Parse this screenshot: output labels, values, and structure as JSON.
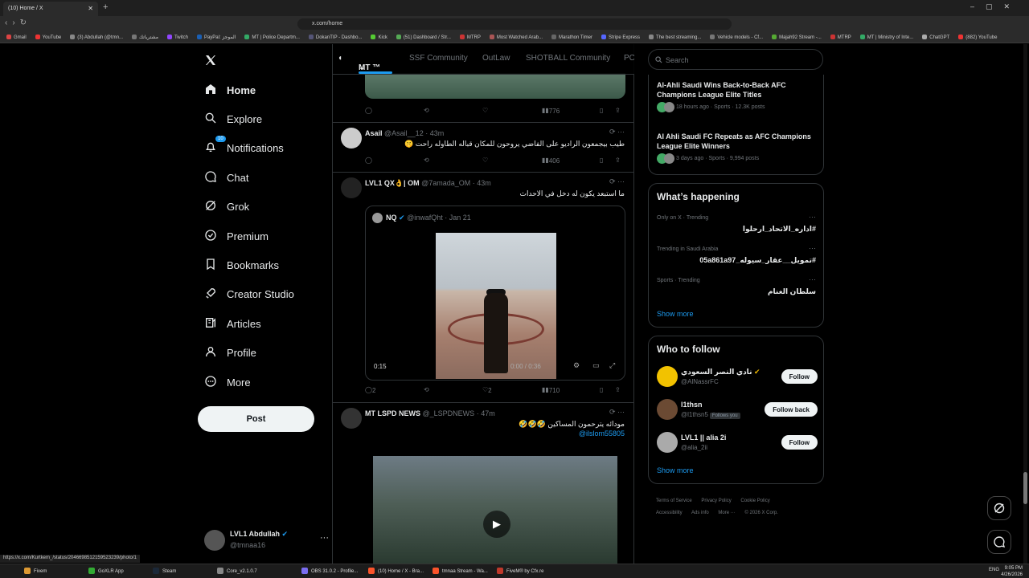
{
  "browser": {
    "tab_title": "(10) Home / X",
    "url": "x.com/home",
    "bookmarks": [
      "Gmail",
      "YouTube",
      "(3) Abdullah (@tmn...",
      "مشترياتك",
      "Twitch",
      "PayPal: الموجز",
      "MT | Police Departm...",
      "DokanTIP - Dashbo...",
      "Kick",
      "(51) Dashboard / Str...",
      "MTRP",
      "Most Watched Arab...",
      "Marathon Timer",
      "Stripe Express",
      "The best streaming...",
      "Vehicle models - Cf...",
      "Majah92 Stream -...",
      "MTRP",
      "MT | Ministry of Inte...",
      "ChatGPT",
      "(882) YouTube"
    ],
    "status_url": "https://x.com/Kurtkem_/status/2046698512159523239/photo/1"
  },
  "nav": {
    "logo": "X",
    "items": [
      {
        "label": "Home",
        "icon": "home-icon"
      },
      {
        "label": "Explore",
        "icon": "search-icon"
      },
      {
        "label": "Notifications",
        "icon": "bell-icon",
        "badge": "10"
      },
      {
        "label": "Chat",
        "icon": "chat-icon"
      },
      {
        "label": "Grok",
        "icon": "grok-icon"
      },
      {
        "label": "Premium",
        "icon": "premium-icon"
      },
      {
        "label": "Bookmarks",
        "icon": "bookmark-icon"
      },
      {
        "label": "Creator Studio",
        "icon": "rocket-icon"
      },
      {
        "label": "Articles",
        "icon": "articles-icon"
      },
      {
        "label": "Profile",
        "icon": "person-icon"
      },
      {
        "label": "More",
        "icon": "more-circle-icon"
      }
    ],
    "post_label": "Post",
    "account": {
      "name": "LVL1 Abdullah",
      "handle": "@tmnaa16"
    }
  },
  "feed": {
    "tabs": [
      "MT ™",
      "SSF Community",
      "OutLaw",
      "SHOTBALL Community",
      "PC"
    ],
    "top_tweet": {
      "views": "776"
    },
    "tweets": [
      {
        "name": "Asail",
        "handle": "@Asail__12",
        "time": "43m",
        "text": "طيب بيجمعون الراديو على الفاضي يروحون للمكان قباله الطاوله راحت 🤫",
        "views": "406"
      },
      {
        "name": "LVL1 QX👌| OM",
        "handle": "@7amada_OM",
        "time": "43m",
        "text": "ما استبعد يكون له دخل في الاحداث",
        "quote": {
          "name": "NQ",
          "handle": "@inwafQht",
          "date": "Jan 21",
          "duration": "0:15",
          "progress": "0:00 / 0:36"
        },
        "replies": "2",
        "likes": "2",
        "views": "710"
      },
      {
        "name": "MT LSPD NEWS",
        "handle": "@_LSPDNEWS",
        "time": "47m",
        "text": "مودائه يترحمون المساكين 🤣🤣🤣",
        "mention": "@ilslom55805"
      }
    ]
  },
  "right": {
    "search_placeholder": "Search",
    "news": [
      {
        "title": "Al-Ahli Saudi Wins Back-to-Back AFC Champions League Elite Titles",
        "meta": "18 hours ago · Sports · 12.3K posts"
      },
      {
        "title": "Al Ahli Saudi FC Repeats as AFC Champions League Elite Winners",
        "meta": "3 days ago · Sports · 9,994 posts"
      }
    ],
    "happening_title": "What’s happening",
    "trends": [
      {
        "context": "Only on X · Trending",
        "topic": "#اداره_الاتحاد_ارحلوا"
      },
      {
        "context": "Trending in Saudi Arabia",
        "topic": "#تمويل__عقار_سيوله_05a861a97"
      },
      {
        "context": "Sports · Trending",
        "topic": "سلطان الغنام"
      }
    ],
    "show_more": "Show more",
    "follow_title": "Who to follow",
    "follows": [
      {
        "name": "نادي النصر السعودي",
        "handle": "@AlNassrFC",
        "button": "Follow"
      },
      {
        "name": "l1thsn",
        "handle": "@l1thsn5",
        "follows_you": "Follows you",
        "button": "Follow back"
      },
      {
        "name": "LVL1 || alia 2i",
        "handle": "@alia_2ii",
        "button": "Follow"
      }
    ],
    "footer": [
      "Terms of Service",
      "Privacy Policy",
      "Cookie Policy",
      "Accessibility",
      "Ads info",
      "More ···",
      "© 2026 X Corp."
    ]
  },
  "taskbar": {
    "apps": [
      "Fivem",
      "GoXLR App",
      "Steam",
      "Core_v2.1.0.7",
      "OBS 31.0.2 - Profile...",
      "(10) Home / X - Bra...",
      "tmnaa Stream - Wa...",
      "FiveM® by Cfx.re"
    ],
    "lang": "ENG",
    "time": "9:05 PM",
    "date": "4/26/2026"
  },
  "colors": {
    "accent": "#1d9bf0",
    "background": "#000000",
    "border": "#2f3336",
    "muted": "#71767b"
  }
}
